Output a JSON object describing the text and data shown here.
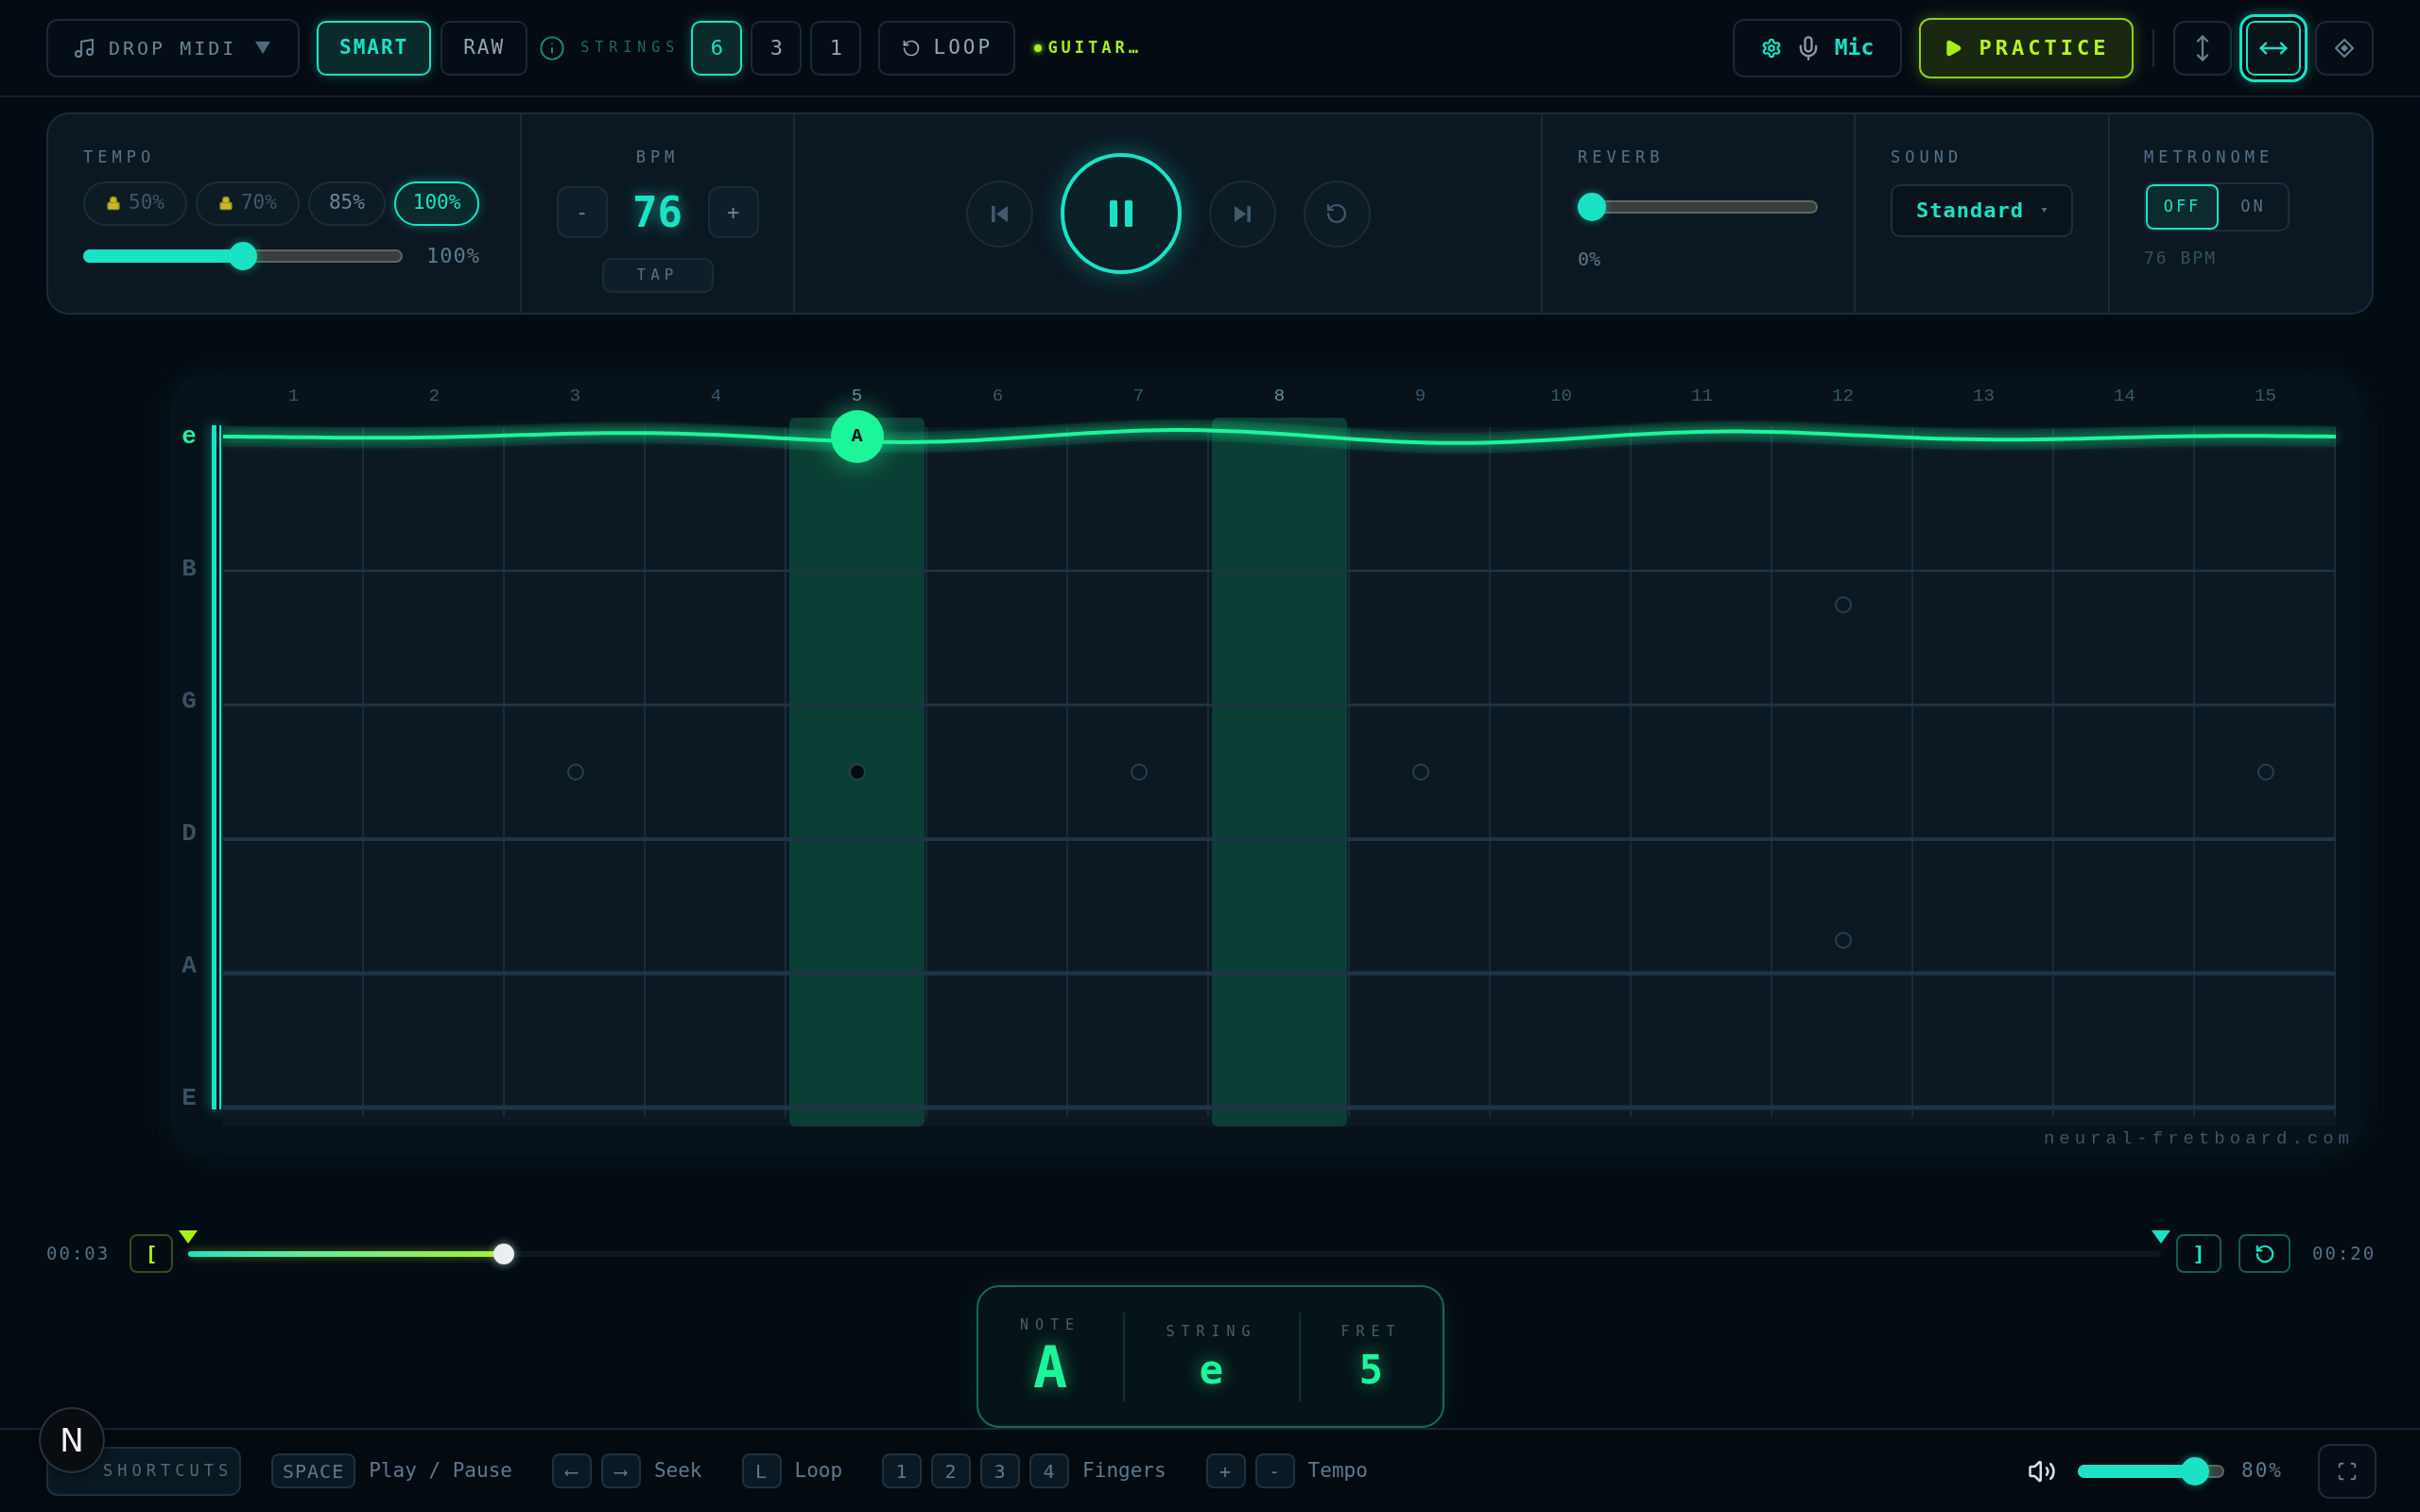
{
  "toolbar": {
    "midi_button": {
      "label": "DROP MIDI"
    },
    "modes": [
      {
        "label": "SMART",
        "selected": true
      },
      {
        "label": "RAW",
        "selected": false
      }
    ],
    "strings_label": "STRINGS",
    "string_counts": [
      {
        "label": "6",
        "selected": true
      },
      {
        "label": "3",
        "selected": false
      },
      {
        "label": "1",
        "selected": false
      }
    ],
    "loop_button": {
      "label": "LOOP"
    },
    "instrument": {
      "label": "GUITAR…"
    },
    "mic_button": {
      "label": "Mic"
    },
    "practice_button": {
      "label": "PRACTICE"
    },
    "view_buttons": [
      {
        "kind": "vertical",
        "selected": false
      },
      {
        "kind": "horizontal",
        "selected": true
      },
      {
        "kind": "diamond",
        "selected": false
      }
    ]
  },
  "controls": {
    "tempo": {
      "label": "TEMPO",
      "presets": [
        {
          "label": "50%",
          "locked": true,
          "selected": false
        },
        {
          "label": "70%",
          "locked": true,
          "selected": false
        },
        {
          "label": "85%",
          "locked": false,
          "selected": false
        },
        {
          "label": "100%",
          "locked": false,
          "selected": true
        }
      ],
      "level": 0.5,
      "reading": "100%"
    },
    "bpm": {
      "label": "BPM",
      "decrement": "-",
      "value": "76",
      "increment": "+",
      "tap": "TAP"
    },
    "transport": {
      "playing": true,
      "buttons": [
        {
          "kind": "previous"
        },
        {
          "kind": "play_pause"
        },
        {
          "kind": "next"
        },
        {
          "kind": "restart"
        }
      ]
    },
    "reverb": {
      "label": "REVERB",
      "level": 0,
      "reading": "0%"
    },
    "sound": {
      "label": "SOUND",
      "value": "Standard"
    },
    "metronome": {
      "label": "METRONOME",
      "options": [
        {
          "label": "OFF",
          "selected": true
        },
        {
          "label": "ON",
          "selected": false
        }
      ],
      "reading": "76 BPM"
    }
  },
  "fretboard": {
    "frets": [
      {
        "number": "1",
        "kind": "plain",
        "highlighted": false
      },
      {
        "number": "2",
        "kind": "plain",
        "highlighted": false
      },
      {
        "number": "3",
        "kind": "dot",
        "highlighted": false
      },
      {
        "number": "4",
        "kind": "plain",
        "highlighted": false
      },
      {
        "number": "5",
        "kind": "dot",
        "highlighted": true,
        "played_note": "A"
      },
      {
        "number": "6",
        "kind": "plain",
        "highlighted": false
      },
      {
        "number": "7",
        "kind": "dot",
        "highlighted": false
      },
      {
        "number": "8",
        "kind": "plain",
        "highlighted": true
      },
      {
        "number": "9",
        "kind": "dot",
        "highlighted": false
      },
      {
        "number": "10",
        "kind": "plain",
        "highlighted": false
      },
      {
        "number": "11",
        "kind": "plain",
        "highlighted": false
      },
      {
        "number": "12",
        "kind": "double",
        "highlighted": false
      },
      {
        "number": "13",
        "kind": "plain",
        "highlighted": false
      },
      {
        "number": "14",
        "kind": "plain",
        "highlighted": false
      },
      {
        "number": "15",
        "kind": "dot",
        "highlighted": false
      }
    ],
    "strings": [
      {
        "label": "e",
        "vibrating": true
      },
      {
        "label": "B",
        "vibrating": false
      },
      {
        "label": "G",
        "vibrating": false
      },
      {
        "label": "D",
        "vibrating": false
      },
      {
        "label": "A",
        "vibrating": false
      },
      {
        "label": "E",
        "vibrating": false
      }
    ],
    "site_label": "neural-fretboard.com"
  },
  "timeline": {
    "elapsed": "00:03",
    "loop_start_button": "[",
    "level": 0.16,
    "loop_end_button": "]",
    "total": "00:20"
  },
  "note_info": [
    {
      "label": "NOTE",
      "value": "A"
    },
    {
      "label": "STRING",
      "value": "e"
    },
    {
      "label": "FRET",
      "value": "5"
    }
  ],
  "bottom_bar": {
    "dev_badge": "N",
    "shortcuts_button": "SHORTCUTS",
    "shortcuts": [
      {
        "keys": [
          "SPACE"
        ],
        "action": "Play / Pause"
      },
      {
        "keys": [
          "⟵",
          "⟶"
        ],
        "action": "Seek"
      },
      {
        "keys": [
          "L"
        ],
        "action": "Loop"
      },
      {
        "keys": [
          "1",
          "2",
          "3",
          "4"
        ],
        "action": "Fingers"
      },
      {
        "keys": [
          "+",
          "-"
        ],
        "action": "Tempo"
      }
    ],
    "volume": {
      "level": 0.8,
      "reading": "80%"
    }
  }
}
